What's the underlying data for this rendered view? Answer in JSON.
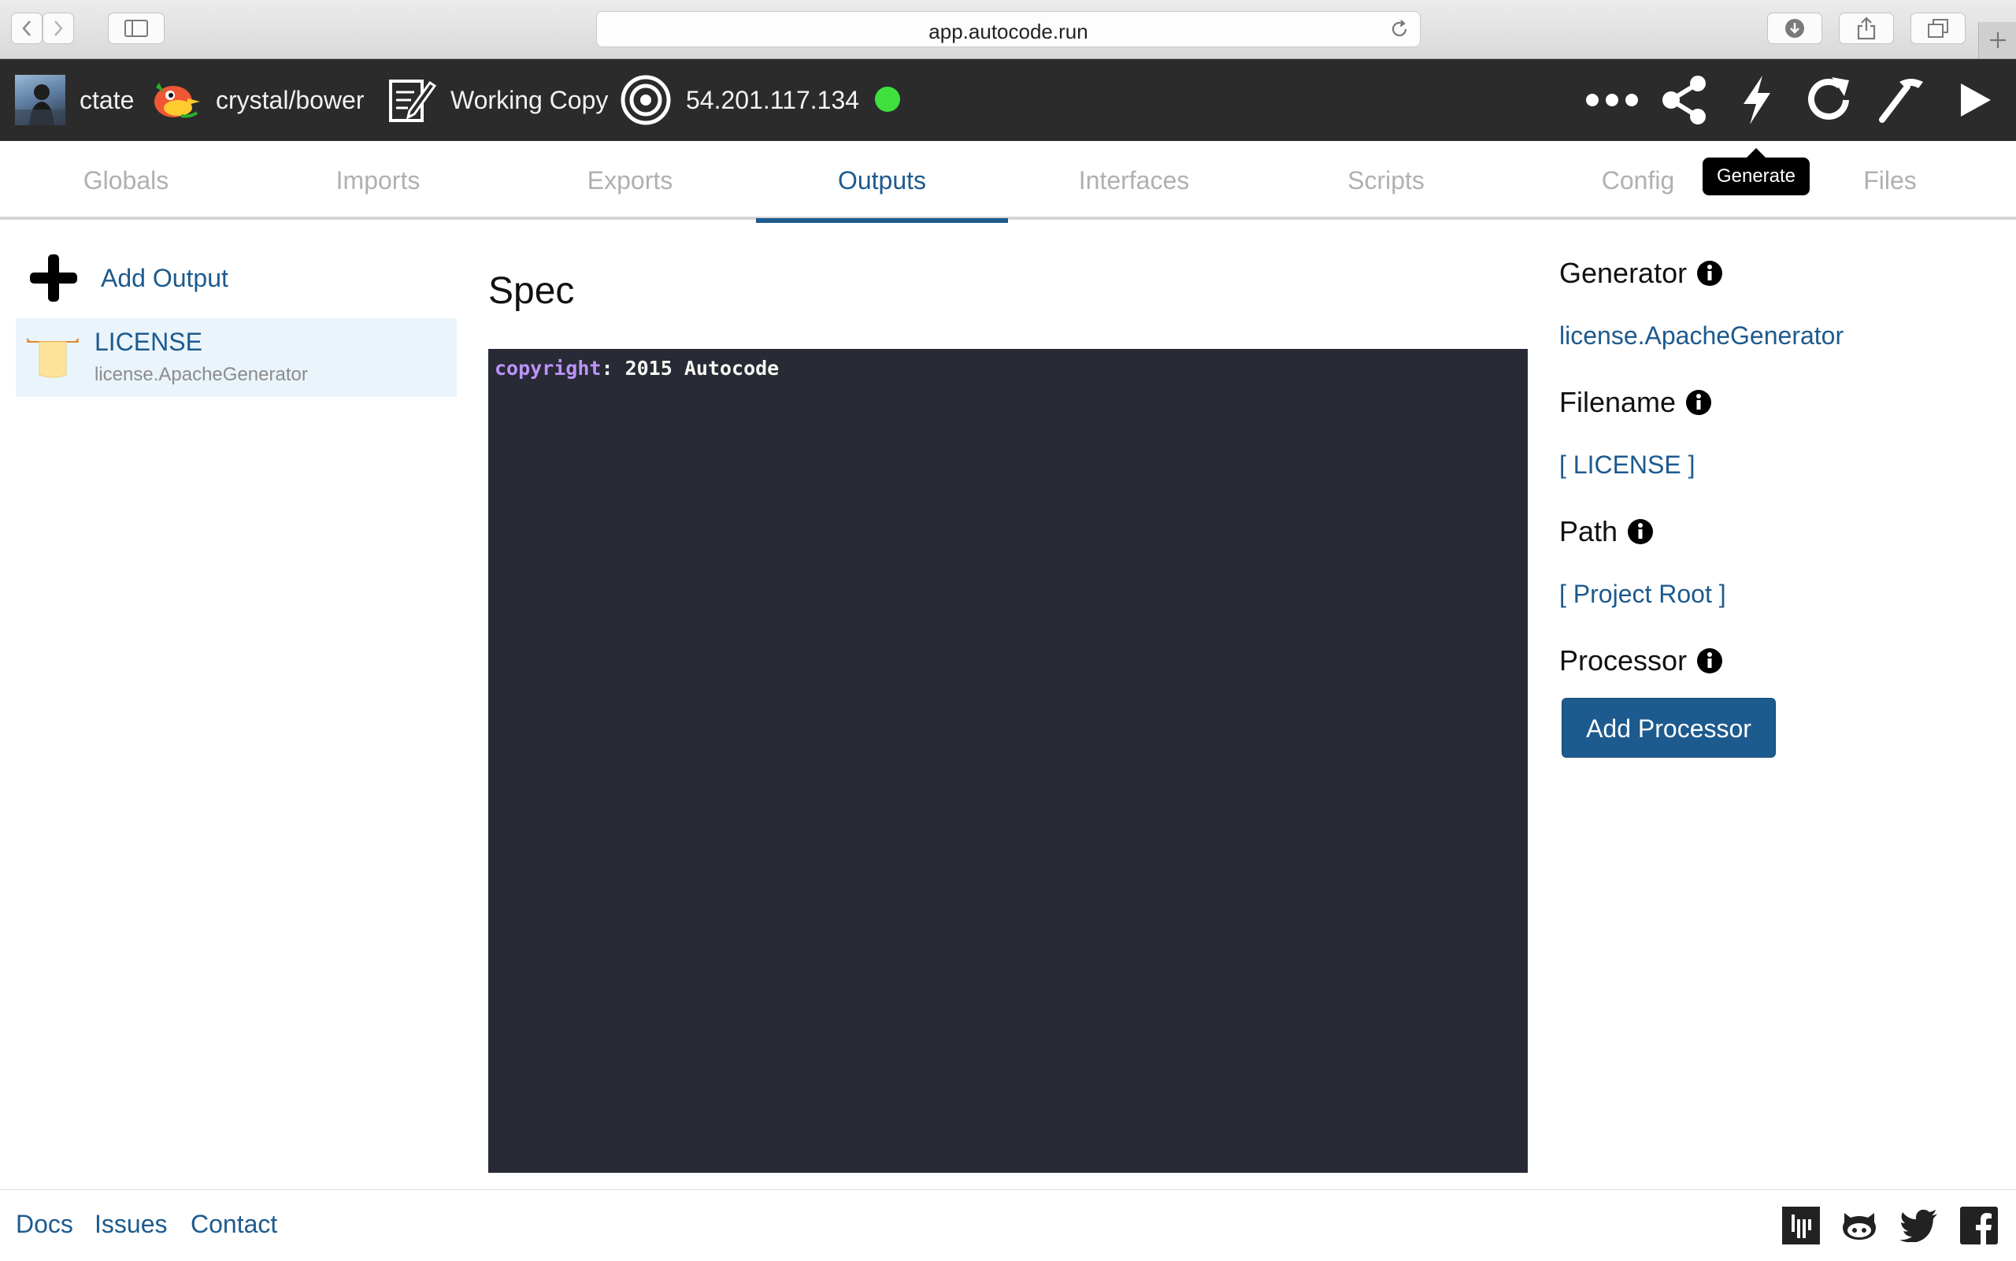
{
  "browser": {
    "url": "app.autocode.run"
  },
  "appbar": {
    "user": "ctate",
    "repo": "crystal/bower",
    "branch": "Working Copy",
    "server_ip": "54.201.117.134",
    "status_color": "#3ee03e"
  },
  "tabs": [
    {
      "label": "Globals"
    },
    {
      "label": "Imports"
    },
    {
      "label": "Exports"
    },
    {
      "label": "Outputs"
    },
    {
      "label": "Interfaces"
    },
    {
      "label": "Scripts"
    },
    {
      "label": "Config"
    },
    {
      "label": "Files"
    }
  ],
  "active_tab": "Outputs",
  "tooltip": "Generate",
  "sidebar": {
    "add_label": "Add Output",
    "items": [
      {
        "name": "LICENSE",
        "generator": "license.ApacheGenerator"
      }
    ]
  },
  "spec": {
    "title": "Spec",
    "code_key": "copyright",
    "code_value": ": 2015 Autocode"
  },
  "details": {
    "generator_label": "Generator",
    "generator_value": "license.ApacheGenerator",
    "filename_label": "Filename",
    "filename_value": "[ LICENSE ]",
    "path_label": "Path",
    "path_value": "[ Project Root ]",
    "processor_label": "Processor",
    "add_processor_label": "Add Processor"
  },
  "footer": {
    "links": [
      "Docs",
      "Issues",
      "Contact"
    ]
  },
  "colors": {
    "accent": "#1d5a8e",
    "toolbar_bg": "#2b2b2b",
    "editor_bg": "#282a36"
  }
}
